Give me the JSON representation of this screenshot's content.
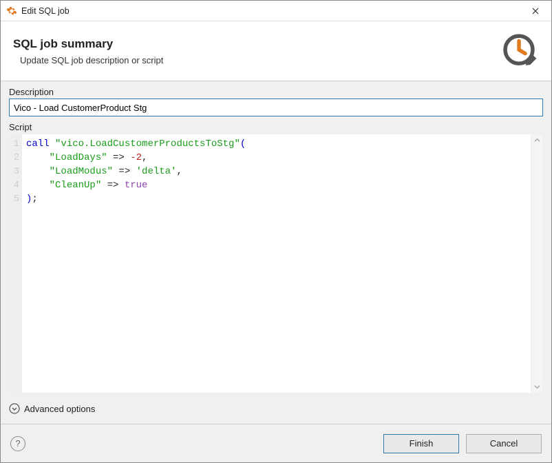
{
  "window": {
    "title": "Edit SQL job"
  },
  "header": {
    "title": "SQL job summary",
    "subtitle": "Update SQL job description or script"
  },
  "form": {
    "description_label": "Description",
    "description_value": "Vico - Load CustomerProduct Stg",
    "script_label": "Script",
    "script_lines": [
      {
        "n": 1,
        "tokens": [
          {
            "t": "call ",
            "c": "kw"
          },
          {
            "t": "\"vico.LoadCustomerProductsToStg\"",
            "c": "str"
          },
          {
            "t": "(",
            "c": "paren"
          }
        ]
      },
      {
        "n": 2,
        "tokens": [
          {
            "t": "    ",
            "c": ""
          },
          {
            "t": "\"LoadDays\"",
            "c": "str"
          },
          {
            "t": " => ",
            "c": ""
          },
          {
            "t": "-2",
            "c": "num"
          },
          {
            "t": ",",
            "c": ""
          }
        ]
      },
      {
        "n": 3,
        "tokens": [
          {
            "t": "    ",
            "c": ""
          },
          {
            "t": "\"LoadModus\"",
            "c": "str"
          },
          {
            "t": " => ",
            "c": ""
          },
          {
            "t": "'delta'",
            "c": "str"
          },
          {
            "t": ",",
            "c": ""
          }
        ]
      },
      {
        "n": 4,
        "tokens": [
          {
            "t": "    ",
            "c": ""
          },
          {
            "t": "\"CleanUp\"",
            "c": "str"
          },
          {
            "t": " => ",
            "c": ""
          },
          {
            "t": "true",
            "c": "const"
          }
        ]
      },
      {
        "n": 5,
        "tokens": [
          {
            "t": ")",
            "c": "paren"
          },
          {
            "t": ";",
            "c": ""
          }
        ]
      }
    ],
    "advanced_label": "Advanced options"
  },
  "footer": {
    "finish_label": "Finish",
    "cancel_label": "Cancel"
  },
  "colors": {
    "accent": "#2a7ab0",
    "app_icon": "#e07a1f"
  }
}
